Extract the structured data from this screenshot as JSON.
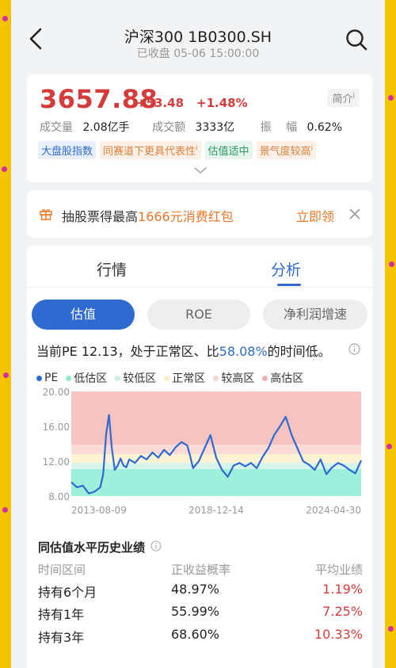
{
  "header": {
    "title": "沪深300 1B0300.SH",
    "subtitle": "已收盘 05-06 15:00:00"
  },
  "quote": {
    "price": "3657.88",
    "change": "+53.48",
    "change_pct": "+1.48%",
    "intro_label": "简介",
    "intro_sup": "i",
    "volume_label": "成交量",
    "volume": "2.08亿手",
    "turnover_label": "成交额",
    "turnover": "3333亿",
    "amplitude_label": "振",
    "amplitude_label2": "幅",
    "amplitude": "0.62%",
    "tags": [
      {
        "text": "大盘股指数",
        "sup": ""
      },
      {
        "text": "同赛道下更具代表性",
        "sup": "i"
      },
      {
        "text": "估值适中",
        "sup": ""
      },
      {
        "text": "景气度较高",
        "sup": "i"
      }
    ]
  },
  "promo": {
    "text_pre": "抽股票得最高",
    "text_highlight": "1666元消费红包",
    "link": "立即领"
  },
  "tabs": {
    "quote": "行情",
    "analysis": "分析",
    "active": "analysis"
  },
  "segments": [
    "估值",
    "ROE",
    "净利润增速"
  ],
  "pe_desc": {
    "pre": "当前PE 12.13，处于正常区、比",
    "pct": "58.08%",
    "post": "的时间低。"
  },
  "legend": [
    {
      "label": "PE",
      "color": "#2f6ad1"
    },
    {
      "label": "低估区",
      "color": "#8ee8cf"
    },
    {
      "label": "较低区",
      "color": "#c8f0e4"
    },
    {
      "label": "正常区",
      "color": "#fbefc8"
    },
    {
      "label": "较高区",
      "color": "#f8d3cf"
    },
    {
      "label": "高估区",
      "color": "#f2b1ae"
    }
  ],
  "chart_data": {
    "type": "line",
    "title": "",
    "xlabel": "",
    "ylabel": "",
    "x_tick_labels": [
      "2013-08-09",
      "2018-12-14",
      "2024-04-30"
    ],
    "y_tick_labels": [
      "20.00",
      "16.00",
      "12.00",
      "8.00"
    ],
    "ylim": [
      8,
      20
    ],
    "bands": [
      {
        "name": "低估区",
        "from": 8,
        "to": 11.1,
        "color": "#9ff0da"
      },
      {
        "name": "较低区",
        "from": 11.1,
        "to": 11.8,
        "color": "#d6f5ea"
      },
      {
        "name": "正常区",
        "from": 11.8,
        "to": 12.8,
        "color": "#fdf3d2"
      },
      {
        "name": "较高区",
        "from": 12.8,
        "to": 13.9,
        "color": "#fadbd6"
      },
      {
        "name": "高估区",
        "from": 13.9,
        "to": 20,
        "color": "#f5c4c0"
      }
    ],
    "series": [
      {
        "name": "PE",
        "color": "#2f6ad1",
        "x_frac": [
          0.0,
          0.02,
          0.04,
          0.06,
          0.08,
          0.1,
          0.11,
          0.12,
          0.13,
          0.14,
          0.15,
          0.16,
          0.17,
          0.18,
          0.19,
          0.2,
          0.22,
          0.24,
          0.26,
          0.28,
          0.3,
          0.32,
          0.34,
          0.36,
          0.38,
          0.4,
          0.41,
          0.42,
          0.44,
          0.46,
          0.48,
          0.5,
          0.52,
          0.54,
          0.56,
          0.58,
          0.6,
          0.62,
          0.64,
          0.66,
          0.68,
          0.7,
          0.72,
          0.74,
          0.76,
          0.78,
          0.8,
          0.82,
          0.84,
          0.86,
          0.88,
          0.9,
          0.92,
          0.94,
          0.96,
          0.98,
          1.0
        ],
        "values": [
          9.6,
          9.0,
          9.2,
          8.3,
          8.5,
          9.0,
          10.5,
          15.0,
          17.3,
          13.5,
          11.0,
          11.5,
          12.3,
          11.5,
          11.3,
          12.2,
          11.8,
          12.6,
          12.2,
          13.0,
          12.4,
          13.3,
          12.7,
          13.6,
          14.2,
          13.8,
          12.6,
          11.2,
          12.0,
          13.5,
          15.0,
          12.4,
          11.0,
          10.2,
          11.5,
          11.8,
          11.4,
          11.8,
          11.2,
          12.5,
          13.5,
          15.0,
          16.0,
          17.1,
          15.0,
          13.5,
          12.0,
          11.6,
          11.0,
          12.2,
          10.5,
          11.3,
          11.8,
          11.5,
          11.0,
          10.6,
          12.1
        ]
      }
    ]
  },
  "history": {
    "title": "同估值水平历史业绩",
    "headers": [
      "时间区间",
      "正收益概率",
      "平均业绩"
    ],
    "rows": [
      {
        "period": "持有6个月",
        "prob": "48.97%",
        "avg": "1.19%"
      },
      {
        "period": "持有1年",
        "prob": "55.99%",
        "avg": "7.25%"
      },
      {
        "period": "持有3年",
        "prob": "68.60%",
        "avg": "10.33%"
      }
    ]
  }
}
